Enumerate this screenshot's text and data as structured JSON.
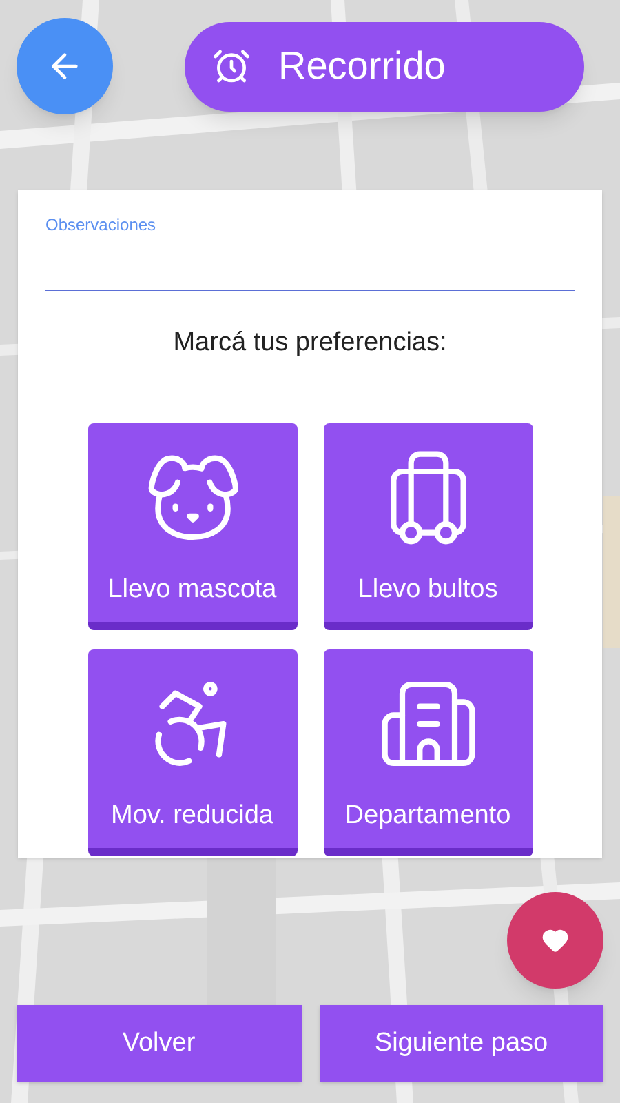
{
  "header": {
    "title": "Recorrido"
  },
  "form": {
    "field_label": "Observaciones",
    "heading": "Marcá tus preferencias:"
  },
  "preferences": [
    {
      "kind": "pet",
      "label": "Llevo mascota"
    },
    {
      "kind": "luggage",
      "label": "Llevo bultos"
    },
    {
      "kind": "mobility",
      "label": "Mov. reducida"
    },
    {
      "kind": "apartment",
      "label": "Departamento"
    }
  ],
  "buttons": [
    {
      "label": "Volver"
    },
    {
      "label": "Siguiente paso"
    }
  ]
}
